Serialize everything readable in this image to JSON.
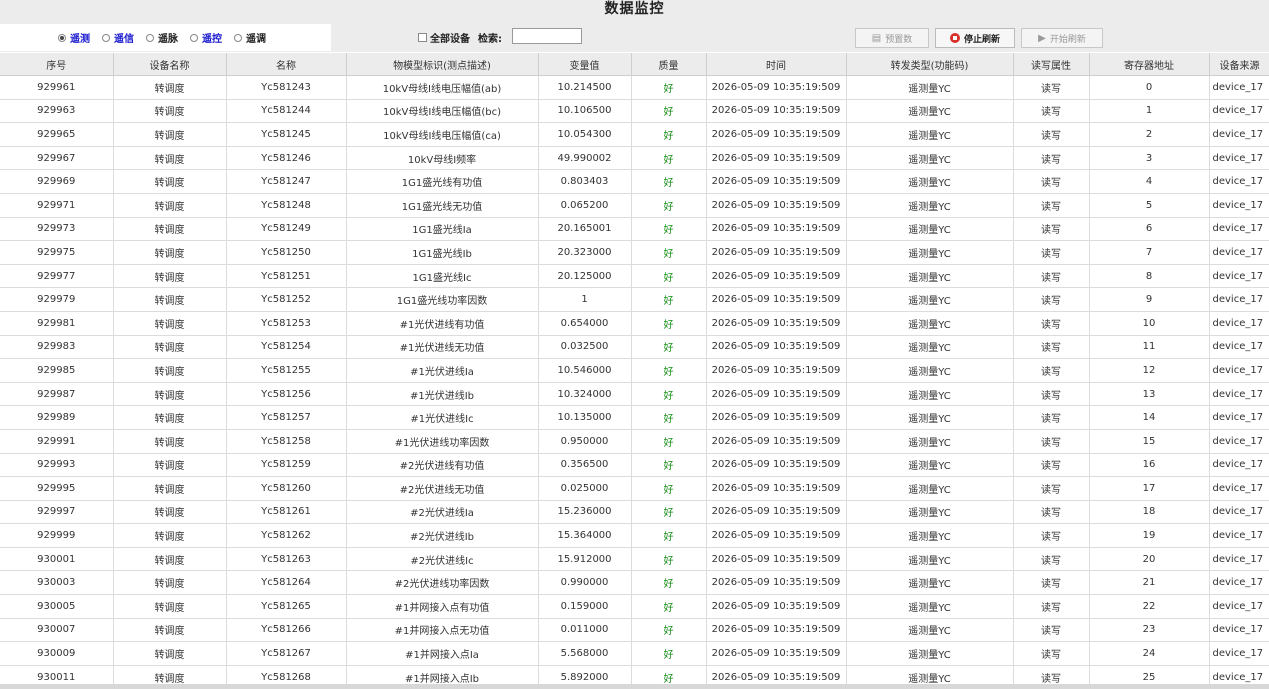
{
  "page_title": "数据监控",
  "radio_options": [
    {
      "label": "遥测",
      "checked": true,
      "color": "blue"
    },
    {
      "label": "遥信",
      "checked": false,
      "color": "blue"
    },
    {
      "label": "遥脉",
      "checked": false,
      "color": "dark"
    },
    {
      "label": "遥控",
      "checked": false,
      "color": "blue"
    },
    {
      "label": "遥调",
      "checked": false,
      "color": "dark"
    }
  ],
  "all_devices_label": "全部设备",
  "search_label": "检索:",
  "search_value": "",
  "buttons": {
    "preset": "预置数",
    "stop_refresh": "停止刷新",
    "start_refresh": "开始刷新"
  },
  "columns": [
    "序号",
    "设备名称",
    "名称",
    "物模型标识(测点描述)",
    "变量值",
    "质量",
    "时间",
    "转发类型(功能码)",
    "读写属性",
    "寄存器地址",
    "设备来源"
  ],
  "rows": [
    [
      "929961",
      "转调度",
      "Yc581243",
      "10kV母线Ⅰ线电压幅值(ab)",
      "10.214500",
      "好",
      "2026-05-09 10:35:19:509",
      "遥测量YC",
      "读写",
      "0",
      "device_17"
    ],
    [
      "929963",
      "转调度",
      "Yc581244",
      "10kV母线Ⅰ线电压幅值(bc)",
      "10.106500",
      "好",
      "2026-05-09 10:35:19:509",
      "遥测量YC",
      "读写",
      "1",
      "device_17"
    ],
    [
      "929965",
      "转调度",
      "Yc581245",
      "10kV母线Ⅰ线电压幅值(ca)",
      "10.054300",
      "好",
      "2026-05-09 10:35:19:509",
      "遥测量YC",
      "读写",
      "2",
      "device_17"
    ],
    [
      "929967",
      "转调度",
      "Yc581246",
      "10kV母线Ⅰ频率",
      "49.990002",
      "好",
      "2026-05-09 10:35:19:509",
      "遥测量YC",
      "读写",
      "3",
      "device_17"
    ],
    [
      "929969",
      "转调度",
      "Yc581247",
      "1G1盛光线有功值",
      "0.803403",
      "好",
      "2026-05-09 10:35:19:509",
      "遥测量YC",
      "读写",
      "4",
      "device_17"
    ],
    [
      "929971",
      "转调度",
      "Yc581248",
      "1G1盛光线无功值",
      "0.065200",
      "好",
      "2026-05-09 10:35:19:509",
      "遥测量YC",
      "读写",
      "5",
      "device_17"
    ],
    [
      "929973",
      "转调度",
      "Yc581249",
      "1G1盛光线Ia",
      "20.165001",
      "好",
      "2026-05-09 10:35:19:509",
      "遥测量YC",
      "读写",
      "6",
      "device_17"
    ],
    [
      "929975",
      "转调度",
      "Yc581250",
      "1G1盛光线Ib",
      "20.323000",
      "好",
      "2026-05-09 10:35:19:509",
      "遥测量YC",
      "读写",
      "7",
      "device_17"
    ],
    [
      "929977",
      "转调度",
      "Yc581251",
      "1G1盛光线Ic",
      "20.125000",
      "好",
      "2026-05-09 10:35:19:509",
      "遥测量YC",
      "读写",
      "8",
      "device_17"
    ],
    [
      "929979",
      "转调度",
      "Yc581252",
      "1G1盛光线功率因数",
      "1",
      "好",
      "2026-05-09 10:35:19:509",
      "遥测量YC",
      "读写",
      "9",
      "device_17"
    ],
    [
      "929981",
      "转调度",
      "Yc581253",
      "#1光伏进线有功值",
      "0.654000",
      "好",
      "2026-05-09 10:35:19:509",
      "遥测量YC",
      "读写",
      "10",
      "device_17"
    ],
    [
      "929983",
      "转调度",
      "Yc581254",
      "#1光伏进线无功值",
      "0.032500",
      "好",
      "2026-05-09 10:35:19:509",
      "遥测量YC",
      "读写",
      "11",
      "device_17"
    ],
    [
      "929985",
      "转调度",
      "Yc581255",
      "#1光伏进线Ia",
      "10.546000",
      "好",
      "2026-05-09 10:35:19:509",
      "遥测量YC",
      "读写",
      "12",
      "device_17"
    ],
    [
      "929987",
      "转调度",
      "Yc581256",
      "#1光伏进线Ib",
      "10.324000",
      "好",
      "2026-05-09 10:35:19:509",
      "遥测量YC",
      "读写",
      "13",
      "device_17"
    ],
    [
      "929989",
      "转调度",
      "Yc581257",
      "#1光伏进线Ic",
      "10.135000",
      "好",
      "2026-05-09 10:35:19:509",
      "遥测量YC",
      "读写",
      "14",
      "device_17"
    ],
    [
      "929991",
      "转调度",
      "Yc581258",
      "#1光伏进线功率因数",
      "0.950000",
      "好",
      "2026-05-09 10:35:19:509",
      "遥测量YC",
      "读写",
      "15",
      "device_17"
    ],
    [
      "929993",
      "转调度",
      "Yc581259",
      "#2光伏进线有功值",
      "0.356500",
      "好",
      "2026-05-09 10:35:19:509",
      "遥测量YC",
      "读写",
      "16",
      "device_17"
    ],
    [
      "929995",
      "转调度",
      "Yc581260",
      "#2光伏进线无功值",
      "0.025000",
      "好",
      "2026-05-09 10:35:19:509",
      "遥测量YC",
      "读写",
      "17",
      "device_17"
    ],
    [
      "929997",
      "转调度",
      "Yc581261",
      "#2光伏进线Ia",
      "15.236000",
      "好",
      "2026-05-09 10:35:19:509",
      "遥测量YC",
      "读写",
      "18",
      "device_17"
    ],
    [
      "929999",
      "转调度",
      "Yc581262",
      "#2光伏进线Ib",
      "15.364000",
      "好",
      "2026-05-09 10:35:19:509",
      "遥测量YC",
      "读写",
      "19",
      "device_17"
    ],
    [
      "930001",
      "转调度",
      "Yc581263",
      "#2光伏进线Ic",
      "15.912000",
      "好",
      "2026-05-09 10:35:19:509",
      "遥测量YC",
      "读写",
      "20",
      "device_17"
    ],
    [
      "930003",
      "转调度",
      "Yc581264",
      "#2光伏进线功率因数",
      "0.990000",
      "好",
      "2026-05-09 10:35:19:509",
      "遥测量YC",
      "读写",
      "21",
      "device_17"
    ],
    [
      "930005",
      "转调度",
      "Yc581265",
      "#1并网接入点有功值",
      "0.159000",
      "好",
      "2026-05-09 10:35:19:509",
      "遥测量YC",
      "读写",
      "22",
      "device_17"
    ],
    [
      "930007",
      "转调度",
      "Yc581266",
      "#1并网接入点无功值",
      "0.011000",
      "好",
      "2026-05-09 10:35:19:509",
      "遥测量YC",
      "读写",
      "23",
      "device_17"
    ],
    [
      "930009",
      "转调度",
      "Yc581267",
      "#1并网接入点Ia",
      "5.568000",
      "好",
      "2026-05-09 10:35:19:509",
      "遥测量YC",
      "读写",
      "24",
      "device_17"
    ],
    [
      "930011",
      "转调度",
      "Yc581268",
      "#1并网接入点Ib",
      "5.892000",
      "好",
      "2026-05-09 10:35:19:509",
      "遥测量YC",
      "读写",
      "25",
      "device_17"
    ]
  ],
  "colors": {
    "header_bg": "#ececec",
    "quality_good": "#1a8f1a",
    "radio_blue": "#1a1ad0",
    "stop_icon": "#d9302b"
  }
}
